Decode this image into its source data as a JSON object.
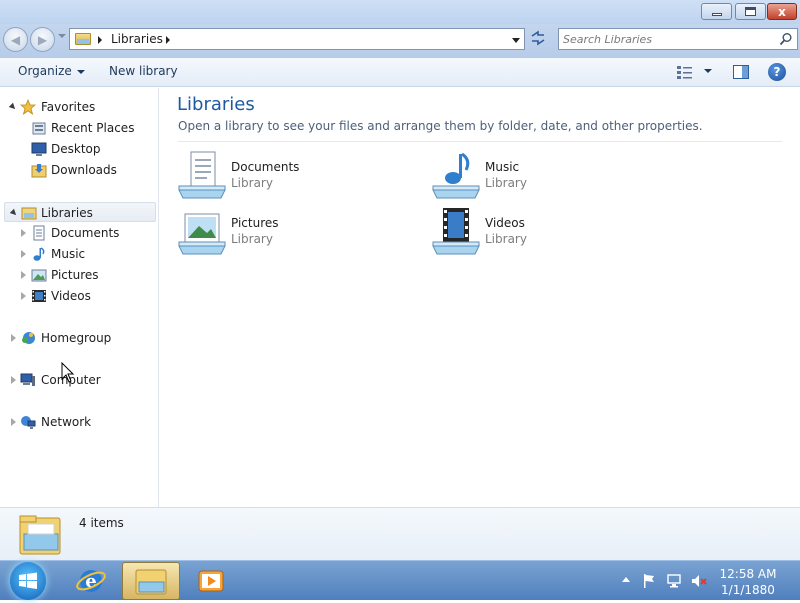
{
  "window": {
    "minimize_icon": "minimize-icon",
    "maximize_icon": "maximize-icon",
    "close_icon": "close-icon",
    "close_glyph": "x"
  },
  "address_bar": {
    "back_icon": "back-arrow-icon",
    "forward_icon": "forward-arrow-icon",
    "path": "Libraries",
    "refresh_icon": "refresh-icon",
    "search_placeholder": "Search Libraries"
  },
  "toolbar": {
    "organize_label": "Organize",
    "new_library_label": "New library",
    "help_glyph": "?"
  },
  "navigation": {
    "favorites": {
      "label": "Favorites",
      "items": [
        {
          "label": "Recent Places",
          "icon": "recent-places-icon"
        },
        {
          "label": "Desktop",
          "icon": "desktop-icon"
        },
        {
          "label": "Downloads",
          "icon": "downloads-icon"
        }
      ]
    },
    "libraries": {
      "label": "Libraries",
      "items": [
        {
          "label": "Documents",
          "icon": "documents-icon"
        },
        {
          "label": "Music",
          "icon": "music-icon"
        },
        {
          "label": "Pictures",
          "icon": "pictures-icon"
        },
        {
          "label": "Videos",
          "icon": "videos-icon"
        }
      ]
    },
    "homegroup": {
      "label": "Homegroup"
    },
    "computer": {
      "label": "Computer"
    },
    "network": {
      "label": "Network"
    }
  },
  "content": {
    "title": "Libraries",
    "subtitle": "Open a library to see your files and arrange them by folder, date, and other properties.",
    "items": [
      {
        "name": "Documents",
        "type": "Library",
        "icon": "documents-library-icon"
      },
      {
        "name": "Music",
        "type": "Library",
        "icon": "music-library-icon"
      },
      {
        "name": "Pictures",
        "type": "Library",
        "icon": "pictures-library-icon"
      },
      {
        "name": "Videos",
        "type": "Library",
        "icon": "videos-library-icon"
      }
    ]
  },
  "details": {
    "item_count": "4 items"
  },
  "taskbar": {
    "clock_time": "12:58 AM",
    "clock_date": "1/1/1880",
    "colors": {
      "taskbar": "#5f8fc8",
      "title_accent": "#1e5aa0"
    }
  }
}
